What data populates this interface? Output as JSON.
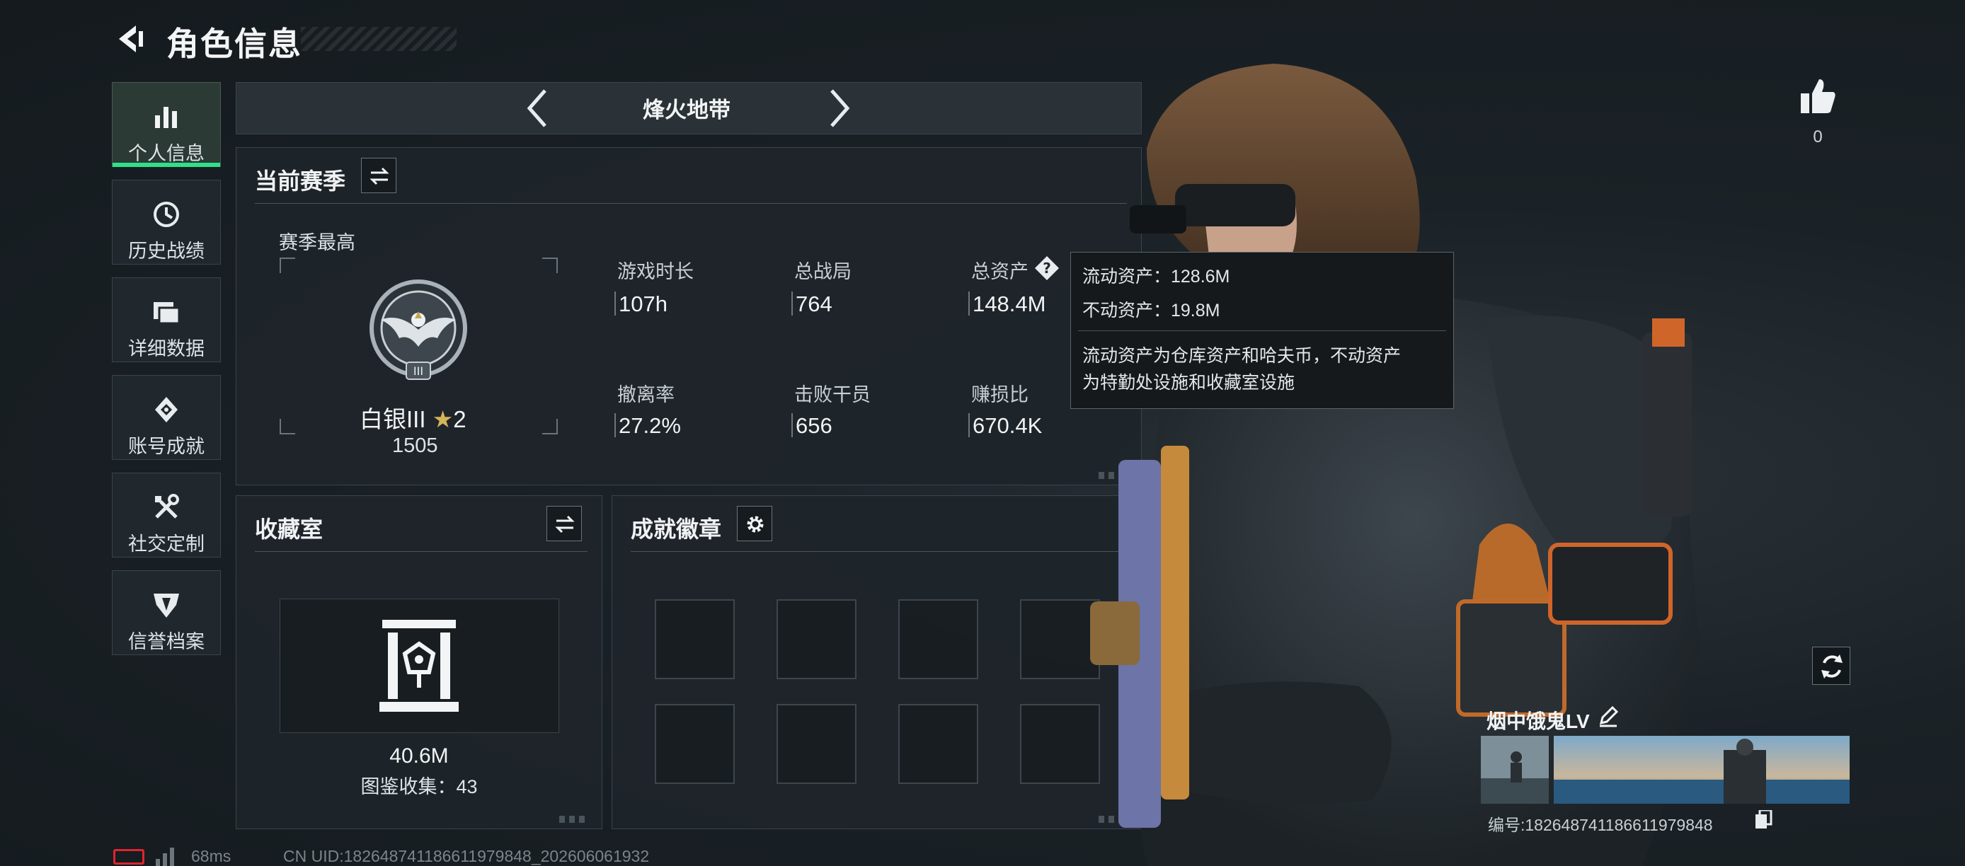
{
  "header": {
    "title": "角色信息"
  },
  "nav": {
    "items": [
      {
        "label": "个人信息",
        "icon": "bar-chart-icon",
        "active": true
      },
      {
        "label": "历史战绩",
        "icon": "history-clock-icon",
        "active": false
      },
      {
        "label": "详细数据",
        "icon": "folder-icon",
        "active": false
      },
      {
        "label": "账号成就",
        "icon": "achievement-medal-icon",
        "active": false
      },
      {
        "label": "社交定制",
        "icon": "tools-icon",
        "active": false
      },
      {
        "label": "信誉档案",
        "icon": "reputation-shield-icon",
        "active": false
      }
    ]
  },
  "mode": {
    "label": "烽火地带"
  },
  "season": {
    "title": "当前赛季",
    "best_label": "赛季最高",
    "rank_name": "白银III",
    "rank_stars": "2",
    "rank_score": "1505",
    "stats": [
      {
        "label": "游戏时长",
        "value": "107h"
      },
      {
        "label": "总战局",
        "value": "764"
      },
      {
        "label": "总资产",
        "value": "148.4M"
      },
      {
        "label": "撤离率",
        "value": "27.2%"
      },
      {
        "label": "击败干员",
        "value": "656"
      },
      {
        "label": "赚损比",
        "value": "670.4K"
      }
    ]
  },
  "tooltip": {
    "line1": "流动资产：128.6M",
    "line2": "不动资产：19.8M",
    "desc1": "流动资产为仓库资产和哈夫币，不动资产",
    "desc2": "为特勤处设施和收藏室设施"
  },
  "collection": {
    "title": "收藏室",
    "value": "40.6M",
    "count_text": "图鉴收集：43"
  },
  "badges": {
    "title": "成就徽章",
    "slots": 8
  },
  "profile": {
    "likes": "0",
    "player_name": "烟中饿鬼LV",
    "player_id": "编号:1826487411866119798​48"
  },
  "footer": {
    "ping": "68ms",
    "uid": "CN UID:1826487411866119798​48_202606061932"
  },
  "colors": {
    "accent": "#2fe08a",
    "battery": "#e0242e"
  }
}
